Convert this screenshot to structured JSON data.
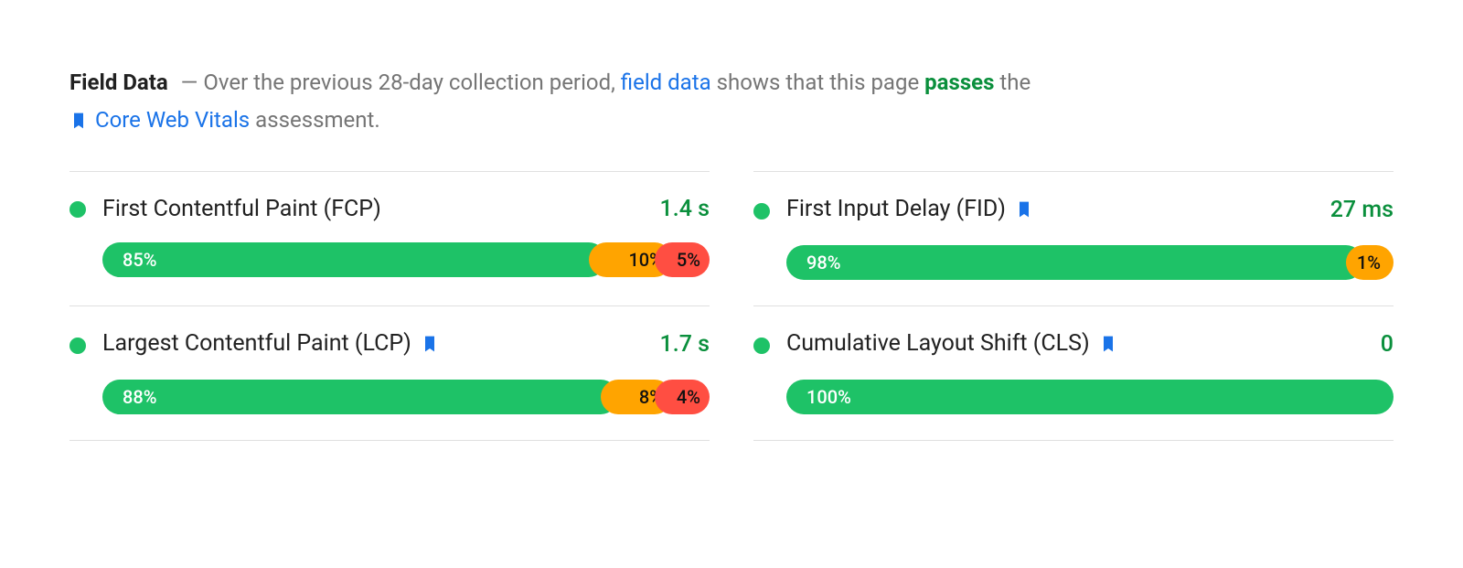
{
  "header": {
    "title": "Field Data",
    "dash": "—",
    "pre_text": "Over the previous 28-day collection period,",
    "link_text": "field data",
    "mid_text": "shows that this page",
    "passes_text": "passes",
    "post_text": "the",
    "cwv_link": "Core Web Vitals",
    "tail_text": "assessment."
  },
  "chart_data": {
    "type": "bar",
    "metrics": [
      {
        "id": "fcp",
        "name": "First Contentful Paint (FCP)",
        "status": "good",
        "value": "1.4 s",
        "cwv_badge": false,
        "distribution": {
          "good": 85,
          "needs_improvement": 10,
          "poor": 5
        }
      },
      {
        "id": "fid",
        "name": "First Input Delay (FID)",
        "status": "good",
        "value": "27 ms",
        "cwv_badge": true,
        "distribution": {
          "good": 98,
          "needs_improvement": 1,
          "poor": 0
        }
      },
      {
        "id": "lcp",
        "name": "Largest Contentful Paint (LCP)",
        "status": "good",
        "value": "1.7 s",
        "cwv_badge": true,
        "distribution": {
          "good": 88,
          "needs_improvement": 8,
          "poor": 4
        }
      },
      {
        "id": "cls",
        "name": "Cumulative Layout Shift (CLS)",
        "status": "good",
        "value": "0",
        "cwv_badge": true,
        "distribution": {
          "good": 100,
          "needs_improvement": 0,
          "poor": 0
        }
      }
    ],
    "colors": {
      "good": "#1ec267",
      "needs_improvement": "#ffa400",
      "poor": "#ff4e42"
    }
  }
}
